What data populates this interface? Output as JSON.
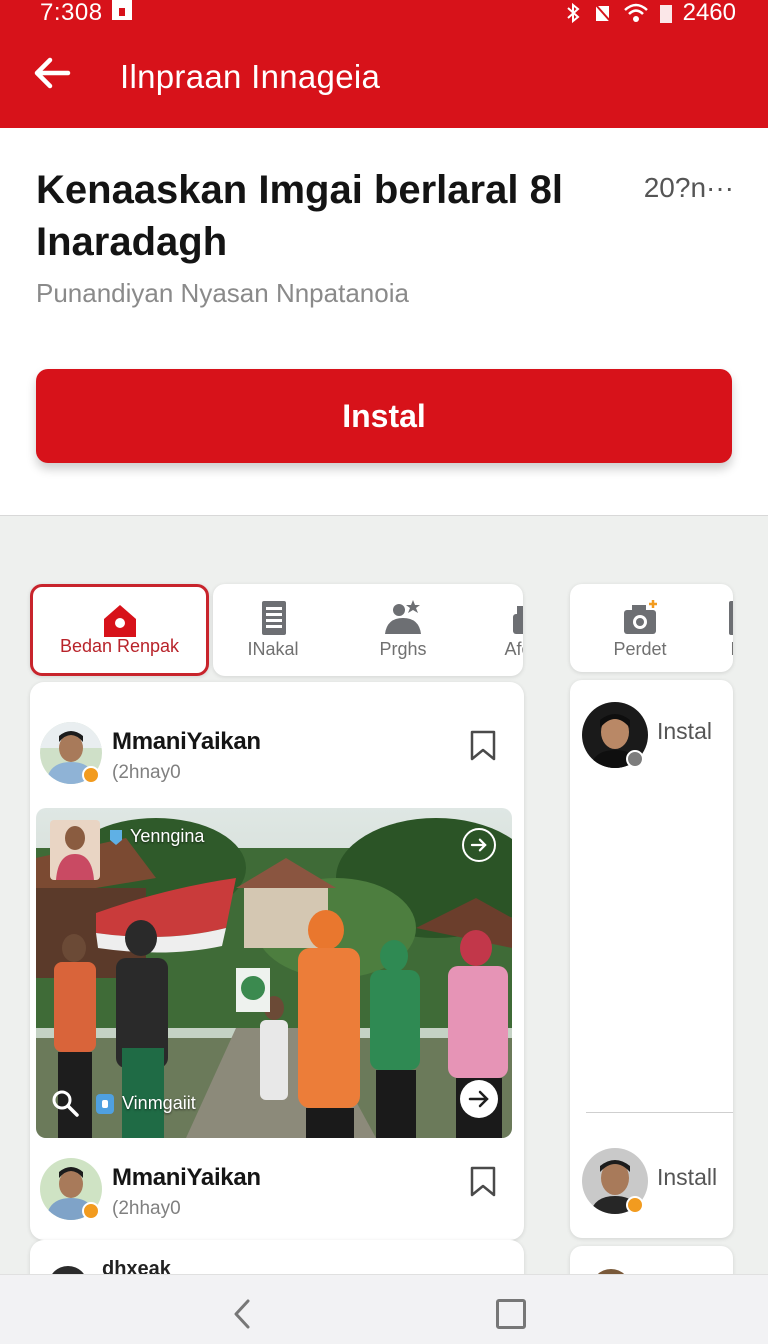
{
  "status_bar": {
    "time": "7:308",
    "battery": "2460"
  },
  "app_bar": {
    "title": "Ilnpraan Innageia",
    "back_icon": "arrow-left-icon"
  },
  "header": {
    "title": "Kenaaskan Imgai berlaral 8l Inaradagh",
    "meta": "20?n···",
    "subtitle": "Punandiyan Nyasan Nnpatanoia",
    "install_label": "Instal"
  },
  "tabs": [
    {
      "label": "Bedan Renpak",
      "icon": "home-icon",
      "active": true
    },
    {
      "label": "INakal",
      "icon": "document-icon",
      "active": false
    },
    {
      "label": "Prghs",
      "icon": "people-icon",
      "active": false
    },
    {
      "label": "Afen",
      "icon": "user-icon",
      "active": false
    }
  ],
  "side_tabs": [
    {
      "label": "Perdet",
      "icon": "camera-icon"
    },
    {
      "label": "Mi",
      "icon": "document-icon"
    }
  ],
  "feed": {
    "posts": [
      {
        "name": "MmaniYaikan",
        "time": "(2hnay0"
      },
      {
        "name": "MmaniYaikan",
        "time": "(2hhay0"
      }
    ],
    "image_tag_top": "Yenngina",
    "image_tag_bottom": "Vinmgaiit",
    "peek_name": "dhxeak"
  },
  "side_feed": {
    "items": [
      {
        "label": "Instal"
      },
      {
        "label": "Install"
      }
    ]
  },
  "colors": {
    "brand_red": "#d7121a",
    "active_tab_border": "#c8242c"
  }
}
